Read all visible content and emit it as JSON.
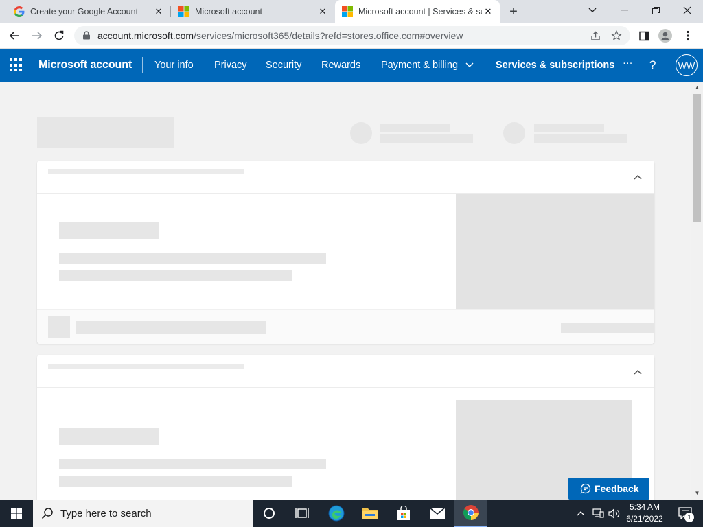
{
  "browser": {
    "tabs": [
      {
        "title": "Create your Google Account",
        "favicon": "google-g-icon",
        "active": false
      },
      {
        "title": "Microsoft account",
        "favicon": "microsoft-logo-icon",
        "active": false
      },
      {
        "title": "Microsoft account | Services & su",
        "favicon": "microsoft-logo-icon",
        "active": true
      }
    ],
    "address": {
      "host": "account.microsoft.com",
      "path": "/services/microsoft365/details?refd=stores.office.com#overview"
    }
  },
  "ms_header": {
    "brand": "Microsoft account",
    "nav": [
      "Your info",
      "Privacy",
      "Security",
      "Rewards",
      "Payment & billing",
      "Services & subscriptions"
    ],
    "more": "···",
    "help": "?",
    "avatar_initials": "WW"
  },
  "content": {
    "state": "loading-skeleton"
  },
  "feedback": {
    "label": "Feedback"
  },
  "taskbar": {
    "search_placeholder": "Type here to search",
    "time": "5:34 AM",
    "date": "6/21/2022",
    "notification_count": "1"
  },
  "colors": {
    "brand_blue": "#0067b8",
    "page_bg": "#f2f2f2",
    "skeleton": "#e6e6e6",
    "taskbar": "#1c2530"
  }
}
